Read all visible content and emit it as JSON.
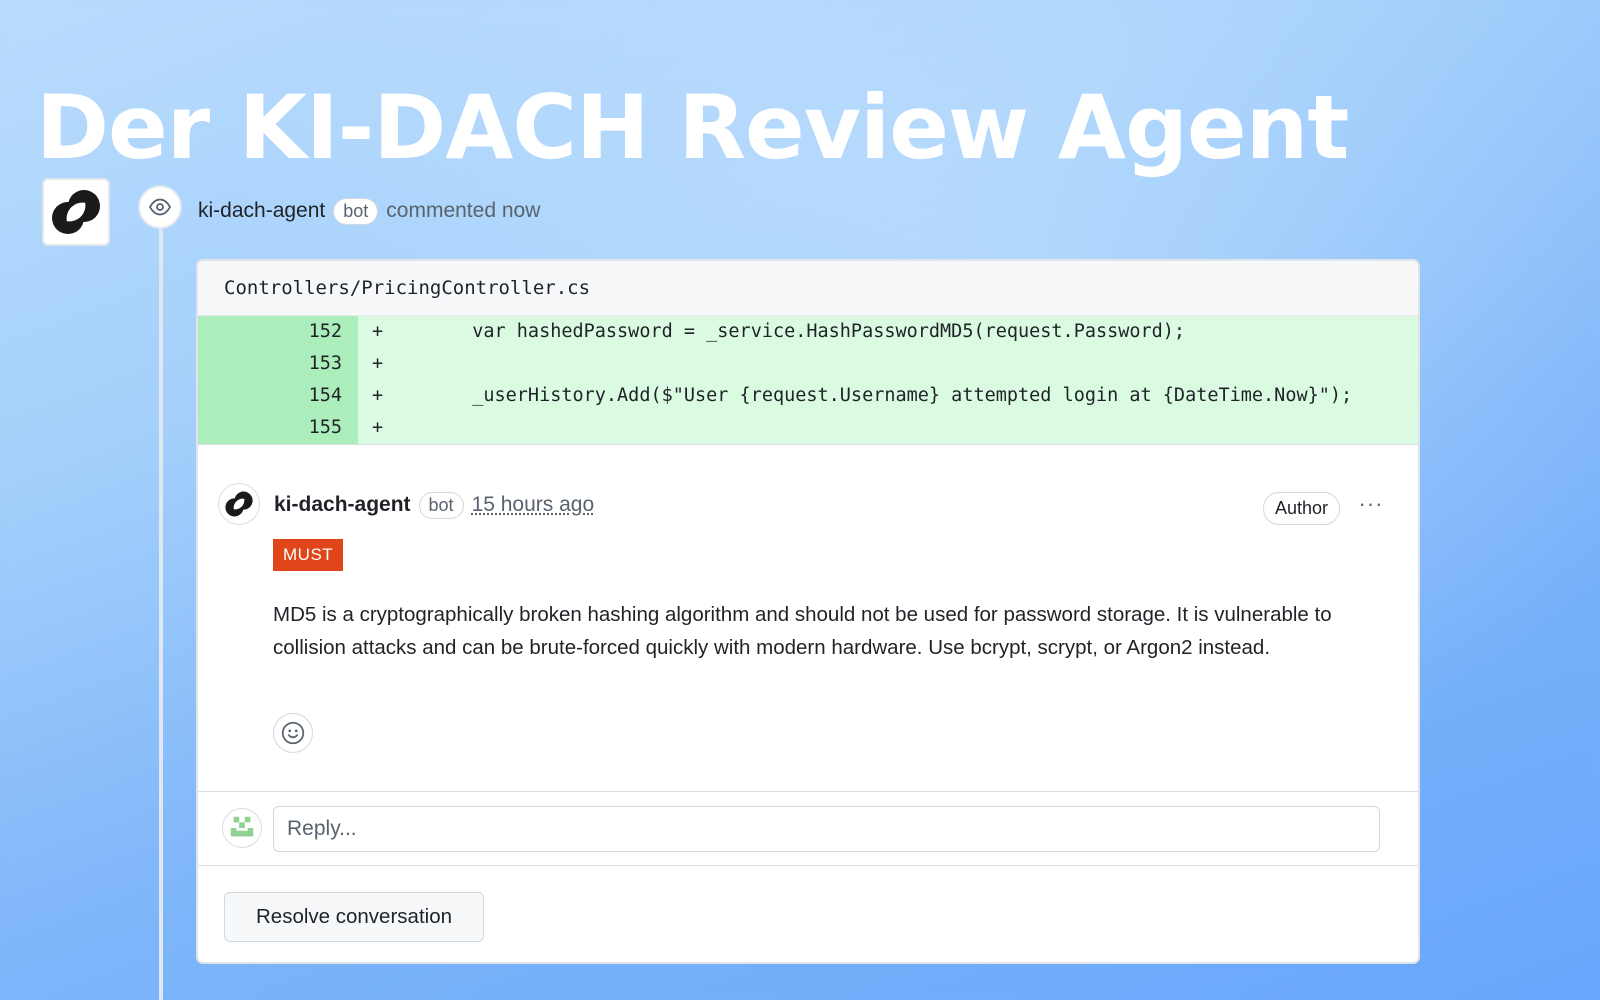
{
  "headline": "Der KI-DACH Review Agent",
  "timeline_event": {
    "user": "ki-dach-agent",
    "badge": "bot",
    "action": "commented now",
    "icon": "eye-icon"
  },
  "file": {
    "path": "Controllers/PricingController.cs"
  },
  "diff_lines": [
    {
      "num": "152",
      "sign": "+",
      "code": "        var hashedPassword = _service.HashPasswordMD5(request.Password);"
    },
    {
      "num": "153",
      "sign": "+",
      "code": ""
    },
    {
      "num": "154",
      "sign": "+",
      "code": "        _userHistory.Add($\"User {request.Username} attempted login at {DateTime.Now}\");"
    },
    {
      "num": "155",
      "sign": "+",
      "code": ""
    }
  ],
  "comment": {
    "user": "ki-dach-agent",
    "badge": "bot",
    "time": "15 hours ago",
    "role": "Author",
    "more_label": "···",
    "label": "MUST",
    "label_color": "#e1461b",
    "body": "MD5 is a cryptographically broken hashing algorithm and should not be used for password storage. It is vulnerable to collision attacks and can be brute-forced quickly with modern hardware. Use bcrypt, scrypt, or Argon2 instead."
  },
  "reply": {
    "placeholder": "Reply..."
  },
  "resolve_button": "Resolve conversation",
  "colors": {
    "diff_add_bg": "#dafbe1",
    "diff_add_num_bg": "#aceebb"
  }
}
